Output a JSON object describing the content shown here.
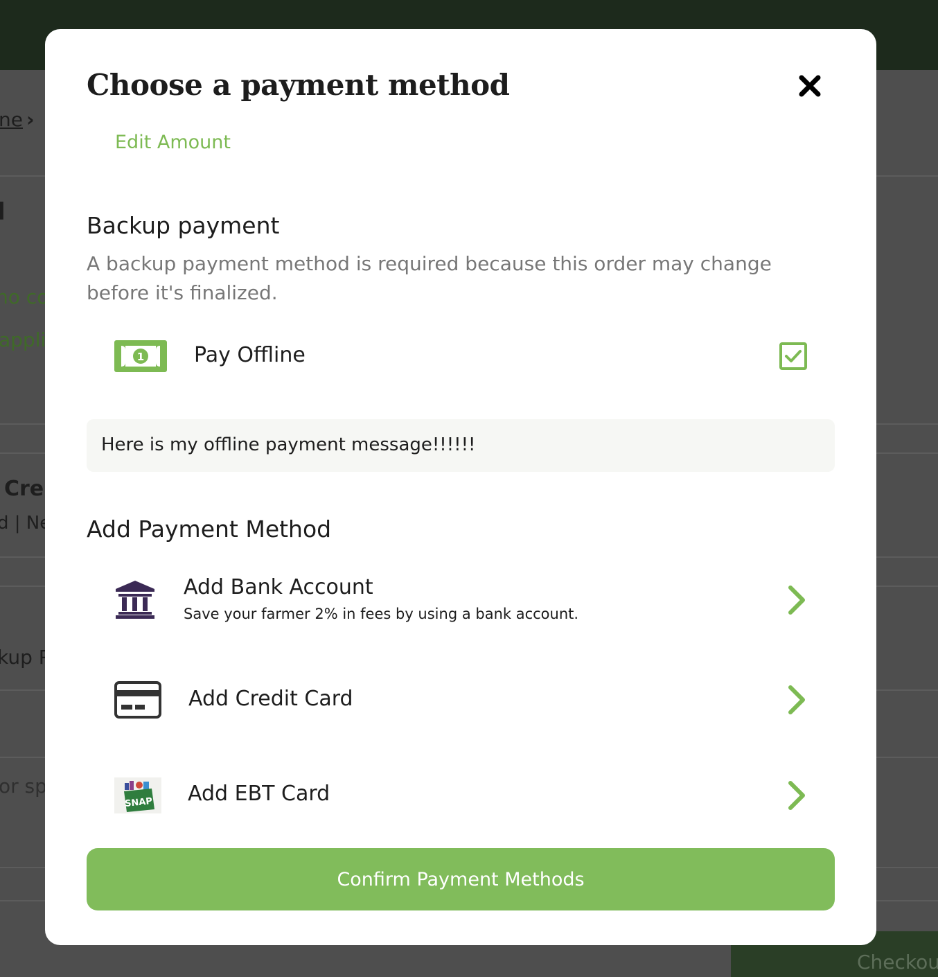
{
  "background": {
    "breadcrumb_fragment": "ne",
    "heading_fragment": "l",
    "promo_fragment": "no co",
    "applied_fragment": "appli",
    "card_title_fragment": "Cre",
    "card_sub_fragment": "d | Ne",
    "backup_fragment": "kup P",
    "notes_fragment": "or sp",
    "checkout_label": "Checkou"
  },
  "modal": {
    "title": "Choose a payment method",
    "edit_amount": "Edit Amount",
    "backup": {
      "heading": "Backup payment",
      "description": "A backup payment method is required because this order may change before it's finalized.",
      "offline_label": "Pay Offline",
      "offline_checked": true,
      "offline_message": "Here is my offline payment message!!!!!!"
    },
    "add_methods": {
      "heading": "Add Payment Method",
      "items": [
        {
          "label": "Add Bank Account",
          "sublabel": "Save your farmer 2% in fees by using a bank account.",
          "icon": "bank-icon"
        },
        {
          "label": "Add Credit Card",
          "icon": "credit-card-icon"
        },
        {
          "label": "Add EBT Card",
          "icon": "snap-icon",
          "icon_text": "SNAP"
        }
      ]
    },
    "confirm_label": "Confirm Payment Methods"
  },
  "colors": {
    "accent": "#81bc5b",
    "link": "#7dba53",
    "text": "#1d1d1d",
    "muted": "#777777",
    "bank_icon": "#3b2a55"
  }
}
